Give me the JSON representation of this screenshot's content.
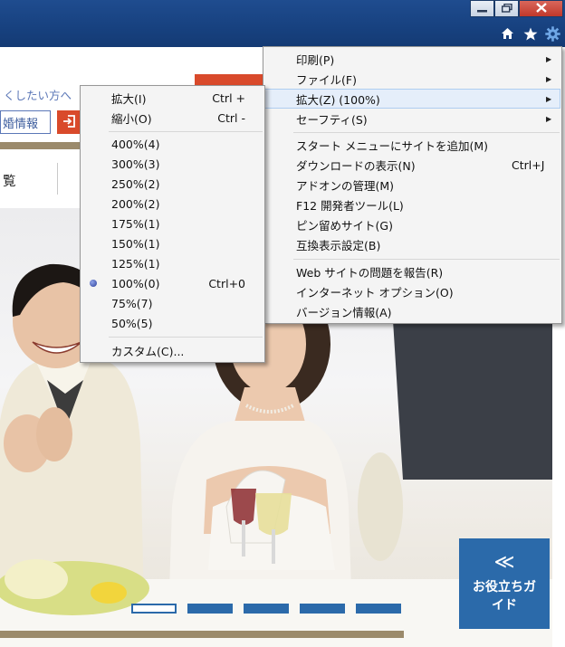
{
  "page": {
    "header_text": "くしたい方へ",
    "header_box": "婚情報",
    "nav_text": "覧",
    "guide_chevron": "≪",
    "guide_label": "お役立ちガイド"
  },
  "tools_menu": {
    "items": [
      {
        "label": "印刷(P)",
        "submenu": true
      },
      {
        "label": "ファイル(F)",
        "submenu": true
      },
      {
        "label": "拡大(Z) (100%)",
        "submenu": true,
        "highlighted": true
      },
      {
        "label": "セーフティ(S)",
        "submenu": true
      },
      {
        "label": "スタート メニューにサイトを追加(M)"
      },
      {
        "label": "ダウンロードの表示(N)",
        "shortcut": "Ctrl+J"
      },
      {
        "label": "アドオンの管理(M)"
      },
      {
        "label": "F12 開発者ツール(L)"
      },
      {
        "label": "ピン留めサイト(G)"
      },
      {
        "label": "互換表示設定(B)"
      },
      {
        "label": "Web サイトの問題を報告(R)"
      },
      {
        "label": "インターネット オプション(O)"
      },
      {
        "label": "バージョン情報(A)"
      }
    ]
  },
  "zoom_menu": {
    "items": [
      {
        "label": "拡大(I)",
        "shortcut": "Ctrl +"
      },
      {
        "label": "縮小(O)",
        "shortcut": "Ctrl -"
      },
      {
        "label": "400%(4)"
      },
      {
        "label": "300%(3)"
      },
      {
        "label": "250%(2)"
      },
      {
        "label": "200%(2)"
      },
      {
        "label": "175%(1)"
      },
      {
        "label": "150%(1)"
      },
      {
        "label": "125%(1)"
      },
      {
        "label": "100%(0)",
        "shortcut": "Ctrl+0",
        "selected": true
      },
      {
        "label": "75%(7)"
      },
      {
        "label": "50%(5)"
      },
      {
        "label": "カスタム(C)..."
      }
    ]
  },
  "colors": {
    "titlebar": "#1f4c8f",
    "accent_red": "#d94a2b",
    "accent_blue": "#2b6aaa",
    "gold_bar": "#9b8a6b",
    "menu_bg": "#f4f4f4",
    "menu_highlight": "#e5eefa"
  },
  "icons": [
    "minimize-icon",
    "maximize-icon",
    "close-icon",
    "home-icon",
    "favorites-star-icon",
    "tools-gear-icon",
    "login-icon",
    "submenu-arrow-icon",
    "radio-selected-icon"
  ]
}
